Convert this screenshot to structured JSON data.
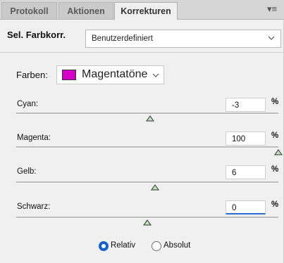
{
  "tabs": [
    {
      "label": "Protokoll",
      "active": false
    },
    {
      "label": "Aktionen",
      "active": false
    },
    {
      "label": "Korrekturen",
      "active": true
    }
  ],
  "panel_menu_icon": "panel-menu-icon",
  "header": {
    "title": "Sel. Farbkorr.",
    "preset_value": "Benutzerdefiniert"
  },
  "farben": {
    "label": "Farben:",
    "value": "Magentatöne",
    "swatch_color": "#d400c8"
  },
  "sliders": [
    {
      "label": "Cyan:",
      "value": "-3",
      "unit": "%",
      "position": 0.51
    },
    {
      "label": "Magenta:",
      "value": "100",
      "unit": "%",
      "position": 1.0
    },
    {
      "label": "Gelb:",
      "value": "6",
      "unit": "%",
      "position": 0.53
    },
    {
      "label": "Schwarz:",
      "value": "0",
      "unit": "%",
      "position": 0.5
    }
  ],
  "method": {
    "options": [
      {
        "label": "Relativ",
        "checked": true
      },
      {
        "label": "Absolut",
        "checked": false
      }
    ]
  },
  "colors": {
    "accent": "#1a63c6",
    "thumb_fill": "#bfe3b6"
  }
}
